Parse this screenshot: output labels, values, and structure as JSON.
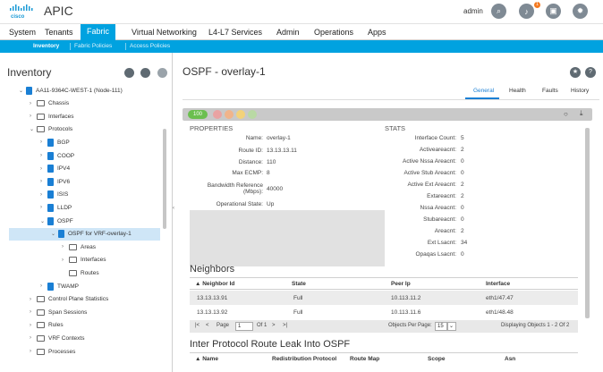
{
  "header": {
    "app_title": "APIC",
    "user": "admin",
    "notification_count": "1",
    "brand_color": "#00a2e0"
  },
  "menu": {
    "items": [
      "System",
      "Tenants",
      "Fabric",
      "Virtual Networking",
      "L4-L7 Services",
      "Admin",
      "Operations",
      "Apps"
    ],
    "active": "Fabric"
  },
  "submenu": {
    "items": [
      "Inventory",
      "Fabric Policies",
      "Access Policies"
    ],
    "active": "Inventory"
  },
  "left": {
    "title": "Inventory",
    "tree": [
      {
        "label": "AA11-9364C-WEST-1 (Node-111)",
        "icon": "node-icon",
        "indent": 0,
        "chev": "v"
      },
      {
        "label": "Chassis",
        "icon": "folder-icon",
        "indent": 1,
        "chev": ">"
      },
      {
        "label": "Interfaces",
        "icon": "folder-icon",
        "indent": 1,
        "chev": ">"
      },
      {
        "label": "Protocols",
        "icon": "folder-icon",
        "indent": 1,
        "chev": "v"
      },
      {
        "label": "BGP",
        "icon": "node-icon",
        "indent": 2,
        "chev": ">"
      },
      {
        "label": "COOP",
        "icon": "node-icon",
        "indent": 2,
        "chev": ">"
      },
      {
        "label": "IPV4",
        "icon": "node-icon",
        "indent": 2,
        "chev": ">"
      },
      {
        "label": "IPV6",
        "icon": "node-icon",
        "indent": 2,
        "chev": ">"
      },
      {
        "label": "ISIS",
        "icon": "node-icon",
        "indent": 2,
        "chev": ">"
      },
      {
        "label": "LLDP",
        "icon": "node-icon",
        "indent": 2,
        "chev": ">"
      },
      {
        "label": "OSPF",
        "icon": "node-icon",
        "indent": 2,
        "chev": "v"
      },
      {
        "label": "OSPF for VRF-overlay-1",
        "icon": "node-icon",
        "indent": 3,
        "chev": "v",
        "selected": true
      },
      {
        "label": "Areas",
        "icon": "folder-icon",
        "indent": 4,
        "chev": ">"
      },
      {
        "label": "Interfaces",
        "icon": "folder-icon",
        "indent": 4,
        "chev": ">"
      },
      {
        "label": "Routes",
        "icon": "folder-icon",
        "indent": 4,
        "chev": ""
      },
      {
        "label": "TWAMP",
        "icon": "node-icon",
        "indent": 2,
        "chev": ">"
      },
      {
        "label": "Control Plane Statistics",
        "icon": "folder-icon",
        "indent": 1,
        "chev": ">"
      },
      {
        "label": "Span Sessions",
        "icon": "folder-icon",
        "indent": 1,
        "chev": ">"
      },
      {
        "label": "Rules",
        "icon": "folder-icon",
        "indent": 1,
        "chev": ">"
      },
      {
        "label": "VRF Contexts",
        "icon": "folder-icon",
        "indent": 1,
        "chev": ">"
      },
      {
        "label": "Processes",
        "icon": "folder-icon",
        "indent": 1,
        "chev": ">"
      }
    ]
  },
  "main": {
    "title": "OSPF - overlay-1",
    "tabs": [
      "General",
      "Health",
      "Faults",
      "History"
    ],
    "active_tab": "General",
    "health_score": "100",
    "properties_heading": "PROPERTIES",
    "stats_heading": "STATS",
    "properties": [
      {
        "label": "Name:",
        "value": "overlay-1"
      },
      {
        "label": "Route ID:",
        "value": "13.13.13.11"
      },
      {
        "label": "Distance:",
        "value": "110"
      },
      {
        "label": "Max ECMP:",
        "value": "8"
      },
      {
        "label": "Bandwidth Reference\n(Mbps):",
        "value": "40000"
      },
      {
        "label": "Operational State:",
        "value": "Up"
      }
    ],
    "stats": [
      {
        "label": "Interface Count:",
        "value": "5"
      },
      {
        "label": "Activeareacnt:",
        "value": "2"
      },
      {
        "label": "Active Nssa Areacnt:",
        "value": "0"
      },
      {
        "label": "Active Stub Areacnt:",
        "value": "0"
      },
      {
        "label": "Active Ext Areacnt:",
        "value": "2"
      },
      {
        "label": "Extareacnt:",
        "value": "2"
      },
      {
        "label": "Nssa Areacnt:",
        "value": "0"
      },
      {
        "label": "Stubareacnt:",
        "value": "0"
      },
      {
        "label": "Areacnt:",
        "value": "2"
      },
      {
        "label": "Ext Lsacnt:",
        "value": "34"
      },
      {
        "label": "Opaqas Lsacnt:",
        "value": "0"
      }
    ],
    "neighbors": {
      "heading": "Neighbors",
      "columns": [
        "▲ Neighbor Id",
        "State",
        "Peer Ip",
        "Interface"
      ],
      "rows": [
        [
          "13.13.13.91",
          "Full",
          "10.113.11.2",
          "eth1/47.47"
        ],
        [
          "13.13.13.92",
          "Full",
          "10.113.11.6",
          "eth1/48.48"
        ]
      ],
      "pager": {
        "page_label": "Page",
        "page_value": "1",
        "of_label": "Of 1",
        "per_page_label": "Objects Per Page:",
        "per_page_value": "15",
        "displaying": "Displaying Objects 1 - 2 Of 2"
      }
    },
    "leak": {
      "heading": "Inter Protocol Route Leak Into OSPF",
      "columns": [
        "▲ Name",
        "Redistribution Protocol",
        "Route Map",
        "Scope",
        "Asn"
      ]
    }
  }
}
